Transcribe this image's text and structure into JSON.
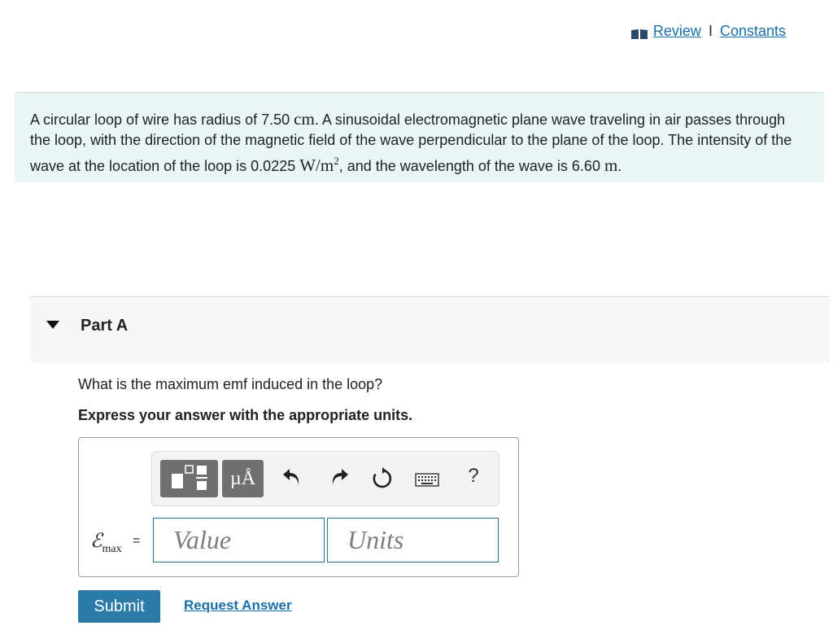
{
  "header": {
    "icon": "book-icon",
    "review_link": "Review",
    "separator": "I",
    "constants_link": "Constants"
  },
  "problem": {
    "t1": "A circular loop of wire has radius of 7.50 ",
    "m1": "cm",
    "t2": ". A sinusoidal electromagnetic plane wave traveling in air passes through the loop, with the direction of the magnetic field of the wave perpendicular to the plane of the loop. The intensity of the wave at the location of the loop is 0.0225 ",
    "m2": "W/m",
    "m2_exp": "2",
    "t3": ", and the wavelength of the wave is 6.60 ",
    "m3": "m",
    "t4": "."
  },
  "part": {
    "title": "Part A",
    "question": "What is the maximum emf induced in the loop?",
    "instruction": "Express your answer with the appropriate units."
  },
  "toolbar": {
    "units_symbol": "µÅ",
    "help": "?",
    "icons": [
      "templates-icon",
      "units-icon",
      "undo-icon",
      "redo-icon",
      "reset-icon",
      "keyboard-icon",
      "help-icon"
    ]
  },
  "answer": {
    "label_symbol": "ℰ",
    "label_sub": "max",
    "equals": "=",
    "value_placeholder": "Value",
    "units_placeholder": "Units"
  },
  "actions": {
    "submit_label": "Submit",
    "request_answer_label": "Request Answer"
  },
  "colors": {
    "link": "#1a6fa8",
    "problem_bg": "#eaf6f6",
    "submit_bg": "#2c7aa8",
    "field_border": "#2a6d90"
  }
}
